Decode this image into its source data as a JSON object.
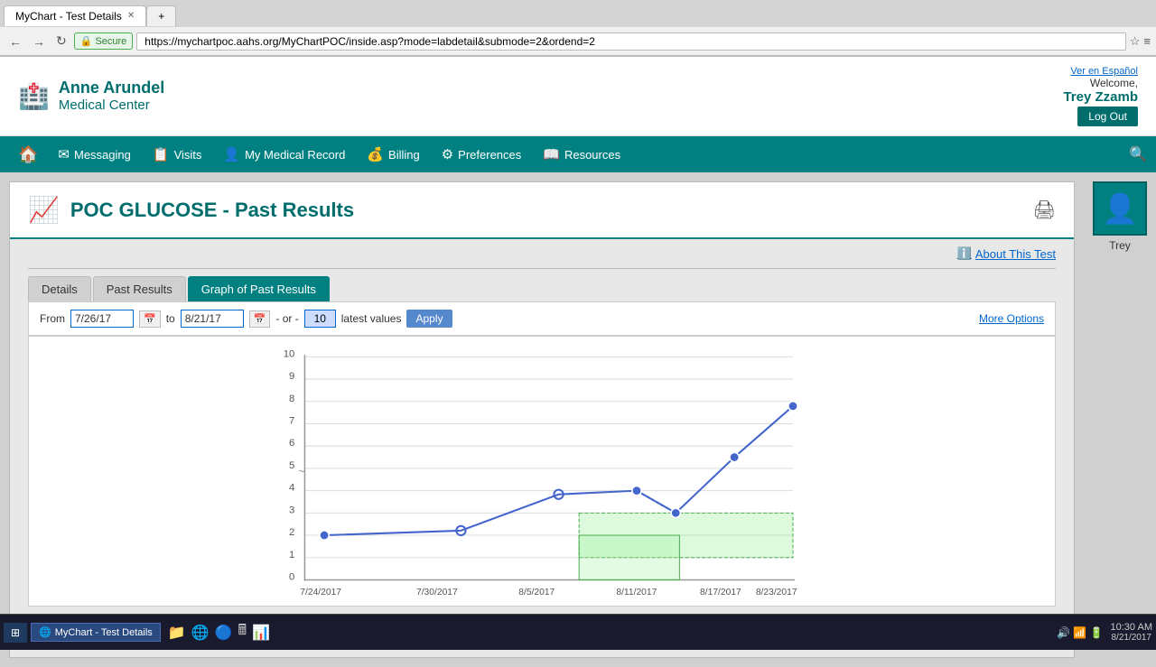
{
  "browser": {
    "tab_title": "MyChart - Test Details",
    "url": "https://mychartpoc.aahs.org/MyChartPOC/inside.asp?mode=labdetail&submode=2&ordend=2",
    "secure_label": "Secure",
    "nav_back": "←",
    "nav_forward": "→",
    "nav_refresh": "↻"
  },
  "header": {
    "logo_line1": "Anne Arundel",
    "logo_line2": "Medical Center",
    "ver_en": "Ver en Español",
    "welcome": "Welcome,",
    "username": "Trey Zzamb",
    "logout": "Log Out"
  },
  "nav": {
    "home_icon": "🏠",
    "items": [
      {
        "label": "Messaging",
        "icon": "✉"
      },
      {
        "label": "Visits",
        "icon": "📋"
      },
      {
        "label": "My Medical Record",
        "icon": "👤"
      },
      {
        "label": "Billing",
        "icon": "💰"
      },
      {
        "label": "Preferences",
        "icon": "⚙"
      },
      {
        "label": "Resources",
        "icon": "📖"
      }
    ]
  },
  "page": {
    "title": "POC GLUCOSE - Past Results",
    "about_test_label": "About This Test"
  },
  "tabs": [
    {
      "label": "Details",
      "active": false
    },
    {
      "label": "Past Results",
      "active": false
    },
    {
      "label": "Graph of Past Results",
      "active": true
    }
  ],
  "filter": {
    "from_label": "From",
    "from_date": "7/26/17",
    "to_label": "to",
    "to_date": "8/21/17",
    "or_label": "- or -",
    "latest_value": "10",
    "latest_label": "latest values",
    "apply_label": "Apply",
    "more_options": "More Options"
  },
  "chart": {
    "y_labels": [
      "0",
      "1",
      "2",
      "3",
      "4",
      "5",
      "6",
      "7",
      "8",
      "9",
      "10"
    ],
    "x_labels": [
      "7/24/2017",
      "7/30/2017",
      "8/5/2017",
      "8/11/2017",
      "8/17/2017",
      "8/23/2017"
    ],
    "data_points": [
      {
        "x": 0.04,
        "y": 2
      },
      {
        "x": 0.32,
        "y": 2.2
      },
      {
        "x": 0.52,
        "y": 3.8
      },
      {
        "x": 0.68,
        "y": 4
      },
      {
        "x": 0.76,
        "y": 3
      },
      {
        "x": 0.88,
        "y": 5.5
      },
      {
        "x": 1.0,
        "y": 7.8
      }
    ],
    "normal_range_min_y": 1,
    "normal_range_max_y": 3
  },
  "avatar": {
    "name": "Trey"
  },
  "taskbar": {
    "start_icon": "⊞",
    "active_tab": "MyChart - Test Details",
    "time": "10:30 AM",
    "date": "8/21/2017"
  }
}
